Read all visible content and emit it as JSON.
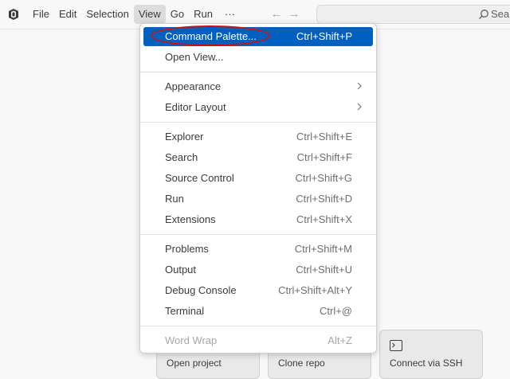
{
  "menubar": {
    "items": [
      "File",
      "Edit",
      "Selection",
      "View",
      "Go",
      "Run",
      "···"
    ],
    "active": "View"
  },
  "nav": {
    "back_icon": "arrow-left-icon",
    "forward_icon": "arrow-right-icon"
  },
  "search": {
    "text": "Sear"
  },
  "view_menu": {
    "items": [
      {
        "label": "Command Palette...",
        "shortcut": "Ctrl+Shift+P"
      },
      {
        "label": "Open View...",
        "shortcut": ""
      },
      {
        "label": "Appearance",
        "shortcut": ""
      },
      {
        "label": "Editor Layout",
        "shortcut": ""
      },
      {
        "label": "Explorer",
        "shortcut": "Ctrl+Shift+E"
      },
      {
        "label": "Search",
        "shortcut": "Ctrl+Shift+F"
      },
      {
        "label": "Source Control",
        "shortcut": "Ctrl+Shift+G"
      },
      {
        "label": "Run",
        "shortcut": "Ctrl+Shift+D"
      },
      {
        "label": "Extensions",
        "shortcut": "Ctrl+Shift+X"
      },
      {
        "label": "Problems",
        "shortcut": "Ctrl+Shift+M"
      },
      {
        "label": "Output",
        "shortcut": "Ctrl+Shift+U"
      },
      {
        "label": "Debug Console",
        "shortcut": "Ctrl+Shift+Alt+Y"
      },
      {
        "label": "Terminal",
        "shortcut": "Ctrl+@"
      },
      {
        "label": "Word Wrap",
        "shortcut": "Alt+Z"
      }
    ],
    "highlighted": "Command Palette...",
    "disabled": "Word Wrap"
  },
  "welcome_tiles": [
    {
      "label": "Open project"
    },
    {
      "label": "Clone repo"
    },
    {
      "label": "Connect via SSH"
    }
  ],
  "colors": {
    "highlight": "#0060c0",
    "annotation": "#d01010"
  }
}
